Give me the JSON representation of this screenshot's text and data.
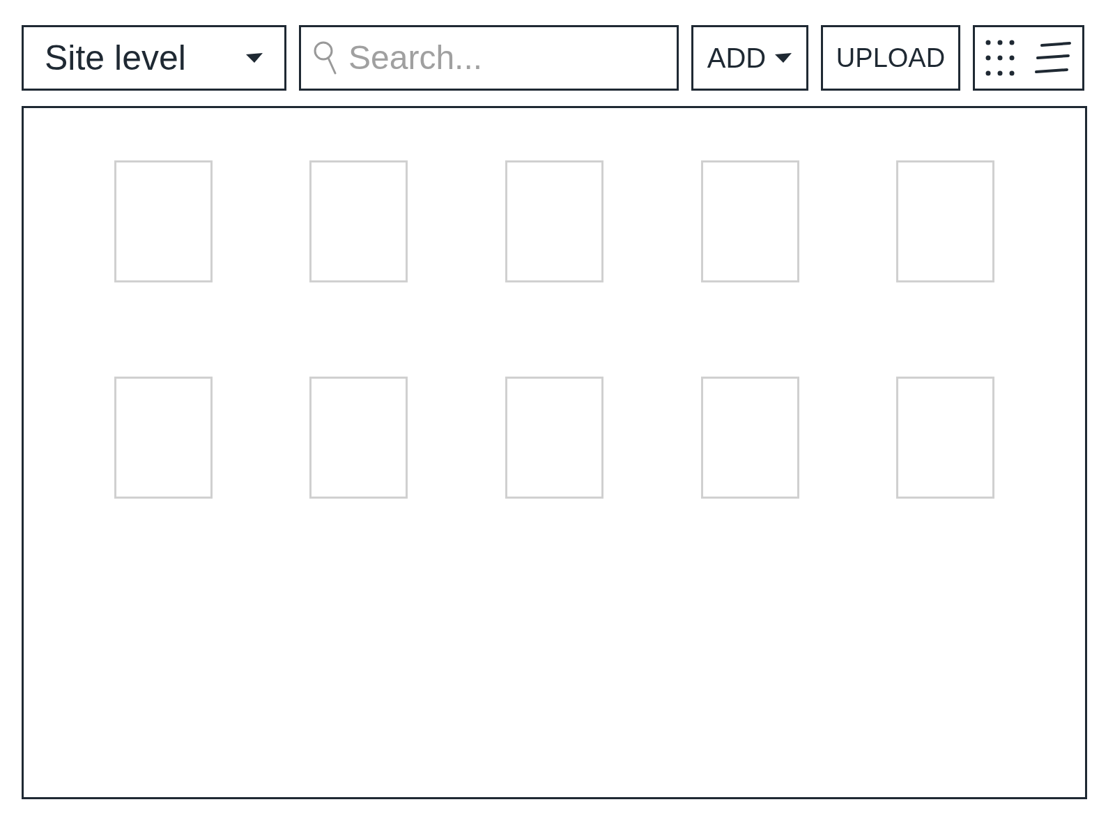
{
  "toolbar": {
    "scope_dropdown": {
      "label": "Site level"
    },
    "search": {
      "placeholder": "Search..."
    },
    "add_button": {
      "label": "ADD"
    },
    "upload_button": {
      "label": "UPLOAD"
    }
  },
  "grid": {
    "tiles": [
      {
        "kind": "placeholder"
      },
      {
        "kind": "placeholder"
      },
      {
        "kind": "placeholder"
      },
      {
        "kind": "placeholder"
      },
      {
        "kind": "placeholder"
      },
      {
        "kind": "placeholder"
      },
      {
        "kind": "placeholder"
      },
      {
        "kind": "placeholder"
      },
      {
        "kind": "placeholder"
      },
      {
        "kind": "placeholder"
      }
    ]
  }
}
